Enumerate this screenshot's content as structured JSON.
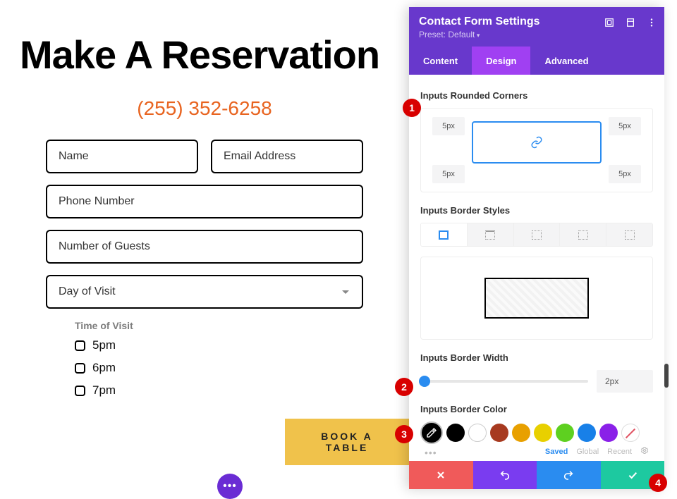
{
  "preview": {
    "title": "Make A Reservation",
    "phone": "(255) 352-6258",
    "fields": {
      "name": "Name",
      "email": "Email Address",
      "phone": "Phone Number",
      "guests": "Number of Guests",
      "day": "Day of Visit"
    },
    "time_label": "Time of Visit",
    "time_options": [
      "5pm",
      "6pm",
      "7pm"
    ],
    "button": "BOOK A TABLE",
    "fab": "•••"
  },
  "panel": {
    "title": "Contact Form Settings",
    "preset": "Preset: Default",
    "tabs": {
      "content": "Content",
      "design": "Design",
      "advanced": "Advanced"
    },
    "rounded_label": "Inputs Rounded Corners",
    "corners": {
      "tl": "5px",
      "tr": "5px",
      "bl": "5px",
      "br": "5px"
    },
    "styles_label": "Inputs Border Styles",
    "width_label": "Inputs Border Width",
    "width_value": "2px",
    "color_label": "Inputs Border Color",
    "swatches": [
      "#000000",
      "#ffffff",
      "#a73a20",
      "#e8a000",
      "#e8d000",
      "#5ed020",
      "#1880e8",
      "#8a20e8",
      "striped"
    ],
    "palette_labels": {
      "saved": "Saved",
      "global": "Global",
      "recent": "Recent"
    },
    "more_dots": "•••"
  },
  "badges": {
    "1": "1",
    "2": "2",
    "3": "3",
    "4": "4"
  }
}
